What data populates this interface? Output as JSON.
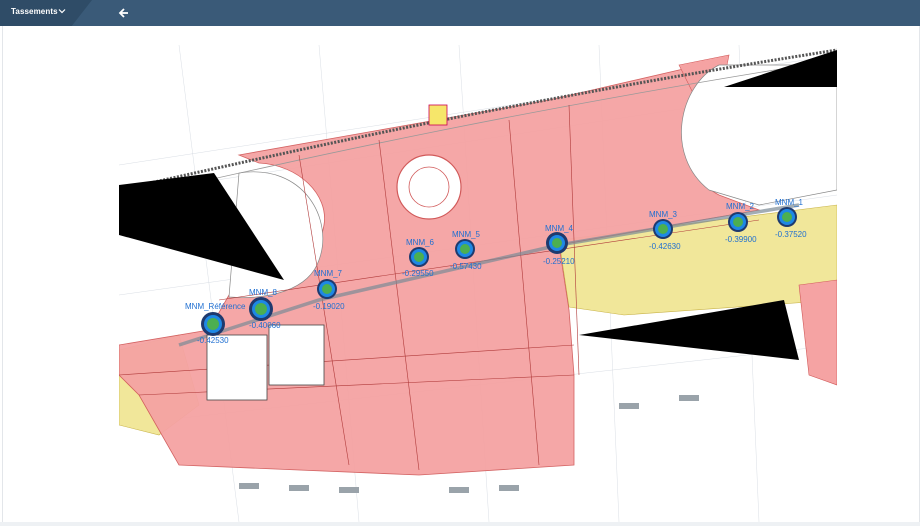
{
  "header": {
    "tab_label": "Tassements",
    "tab_icon": "chevron-down-icon",
    "back_icon": "arrow-left-icon"
  },
  "colors": {
    "header_bg": "#3a5a78",
    "tab_bg": "#2f4c67",
    "zone_red": "#f5a3a3",
    "zone_yellow": "#f1e79a",
    "marker_ring": "#1f3a6e",
    "marker_fill": "#4caf50",
    "marker_text": "#1f6fd1"
  },
  "markers": [
    {
      "name": "MNM_Référence",
      "value": "-0.42530"
    },
    {
      "name": "MNM_8",
      "value": "-0.40060"
    },
    {
      "name": "MNM_7",
      "value": "-0.19020"
    },
    {
      "name": "MNM_6",
      "value": "-0.29550"
    },
    {
      "name": "MNM_5",
      "value": "-0.57430"
    },
    {
      "name": "MNM_4",
      "value": "-0.25210"
    },
    {
      "name": "MNM_3",
      "value": "-0.42630"
    },
    {
      "name": "MNM_2",
      "value": "-0.39900"
    },
    {
      "name": "MNM_1",
      "value": "-0.37520"
    }
  ]
}
